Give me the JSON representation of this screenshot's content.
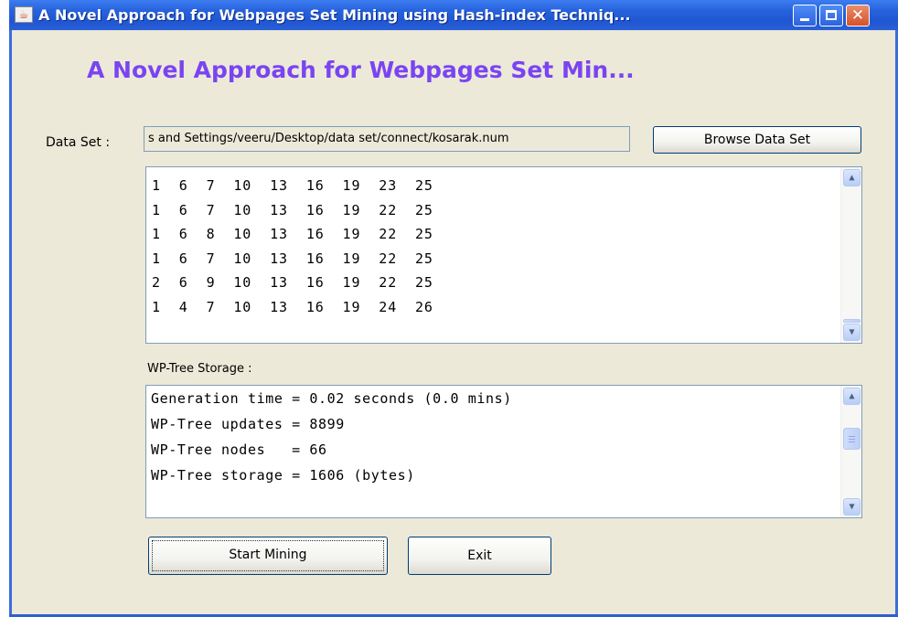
{
  "window": {
    "title": "A Novel Approach for Webpages Set Mining  using Hash-index Techniq...",
    "controls": {
      "minimize": "minimize",
      "maximize": "maximize",
      "close": "✕"
    }
  },
  "banner": "A Novel Approach for Webpages Set Min...",
  "dataset": {
    "label": "Data Set :",
    "path": "s and Settings/veeru/Desktop/data set/connect/kosarak.num",
    "browse_label": "Browse Data Set"
  },
  "data_lines": [
    "1  6  7  10  13  16  19  23  25",
    "1  6  7  10  13  16  19  22  25",
    "1  6  8  10  13  16  19  22  25",
    "1  6  7  10  13  16  19  22  25",
    "2  6  9  10  13  16  19  22  25",
    "1  4  7  10  13  16  19  24  26"
  ],
  "wp_tree": {
    "label": "WP-Tree Storage :",
    "lines": [
      "Generation time = 0.02 seconds (0.0 mins)",
      "WP-Tree updates = 8899",
      "WP-Tree nodes   = 66",
      "WP-Tree storage = 1606 (bytes)"
    ]
  },
  "buttons": {
    "start": "Start Mining",
    "exit": "Exit"
  },
  "colors": {
    "title_bar": "#2762dd",
    "banner": "#7a44f2",
    "panel": "#ece9d8"
  }
}
